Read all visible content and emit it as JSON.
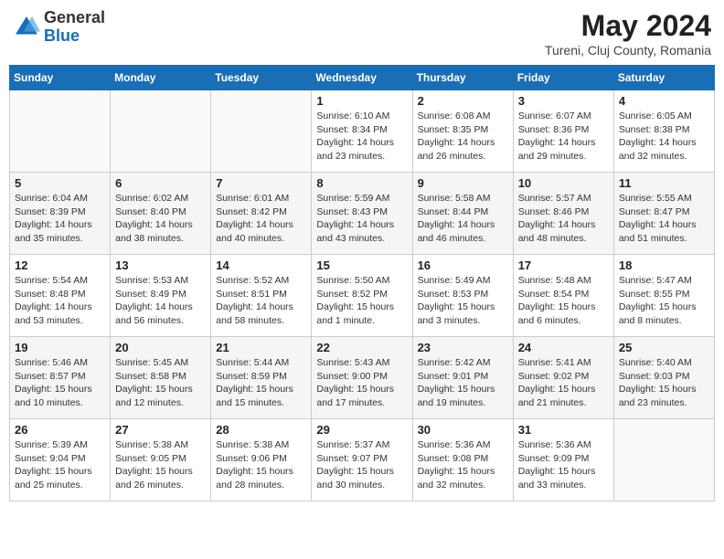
{
  "header": {
    "logo_general": "General",
    "logo_blue": "Blue",
    "month_year": "May 2024",
    "location": "Tureni, Cluj County, Romania"
  },
  "days_of_week": [
    "Sunday",
    "Monday",
    "Tuesday",
    "Wednesday",
    "Thursday",
    "Friday",
    "Saturday"
  ],
  "weeks": [
    [
      {
        "day": "",
        "info": ""
      },
      {
        "day": "",
        "info": ""
      },
      {
        "day": "",
        "info": ""
      },
      {
        "day": "1",
        "info": "Sunrise: 6:10 AM\nSunset: 8:34 PM\nDaylight: 14 hours\nand 23 minutes."
      },
      {
        "day": "2",
        "info": "Sunrise: 6:08 AM\nSunset: 8:35 PM\nDaylight: 14 hours\nand 26 minutes."
      },
      {
        "day": "3",
        "info": "Sunrise: 6:07 AM\nSunset: 8:36 PM\nDaylight: 14 hours\nand 29 minutes."
      },
      {
        "day": "4",
        "info": "Sunrise: 6:05 AM\nSunset: 8:38 PM\nDaylight: 14 hours\nand 32 minutes."
      }
    ],
    [
      {
        "day": "5",
        "info": "Sunrise: 6:04 AM\nSunset: 8:39 PM\nDaylight: 14 hours\nand 35 minutes."
      },
      {
        "day": "6",
        "info": "Sunrise: 6:02 AM\nSunset: 8:40 PM\nDaylight: 14 hours\nand 38 minutes."
      },
      {
        "day": "7",
        "info": "Sunrise: 6:01 AM\nSunset: 8:42 PM\nDaylight: 14 hours\nand 40 minutes."
      },
      {
        "day": "8",
        "info": "Sunrise: 5:59 AM\nSunset: 8:43 PM\nDaylight: 14 hours\nand 43 minutes."
      },
      {
        "day": "9",
        "info": "Sunrise: 5:58 AM\nSunset: 8:44 PM\nDaylight: 14 hours\nand 46 minutes."
      },
      {
        "day": "10",
        "info": "Sunrise: 5:57 AM\nSunset: 8:46 PM\nDaylight: 14 hours\nand 48 minutes."
      },
      {
        "day": "11",
        "info": "Sunrise: 5:55 AM\nSunset: 8:47 PM\nDaylight: 14 hours\nand 51 minutes."
      }
    ],
    [
      {
        "day": "12",
        "info": "Sunrise: 5:54 AM\nSunset: 8:48 PM\nDaylight: 14 hours\nand 53 minutes."
      },
      {
        "day": "13",
        "info": "Sunrise: 5:53 AM\nSunset: 8:49 PM\nDaylight: 14 hours\nand 56 minutes."
      },
      {
        "day": "14",
        "info": "Sunrise: 5:52 AM\nSunset: 8:51 PM\nDaylight: 14 hours\nand 58 minutes."
      },
      {
        "day": "15",
        "info": "Sunrise: 5:50 AM\nSunset: 8:52 PM\nDaylight: 15 hours\nand 1 minute."
      },
      {
        "day": "16",
        "info": "Sunrise: 5:49 AM\nSunset: 8:53 PM\nDaylight: 15 hours\nand 3 minutes."
      },
      {
        "day": "17",
        "info": "Sunrise: 5:48 AM\nSunset: 8:54 PM\nDaylight: 15 hours\nand 6 minutes."
      },
      {
        "day": "18",
        "info": "Sunrise: 5:47 AM\nSunset: 8:55 PM\nDaylight: 15 hours\nand 8 minutes."
      }
    ],
    [
      {
        "day": "19",
        "info": "Sunrise: 5:46 AM\nSunset: 8:57 PM\nDaylight: 15 hours\nand 10 minutes."
      },
      {
        "day": "20",
        "info": "Sunrise: 5:45 AM\nSunset: 8:58 PM\nDaylight: 15 hours\nand 12 minutes."
      },
      {
        "day": "21",
        "info": "Sunrise: 5:44 AM\nSunset: 8:59 PM\nDaylight: 15 hours\nand 15 minutes."
      },
      {
        "day": "22",
        "info": "Sunrise: 5:43 AM\nSunset: 9:00 PM\nDaylight: 15 hours\nand 17 minutes."
      },
      {
        "day": "23",
        "info": "Sunrise: 5:42 AM\nSunset: 9:01 PM\nDaylight: 15 hours\nand 19 minutes."
      },
      {
        "day": "24",
        "info": "Sunrise: 5:41 AM\nSunset: 9:02 PM\nDaylight: 15 hours\nand 21 minutes."
      },
      {
        "day": "25",
        "info": "Sunrise: 5:40 AM\nSunset: 9:03 PM\nDaylight: 15 hours\nand 23 minutes."
      }
    ],
    [
      {
        "day": "26",
        "info": "Sunrise: 5:39 AM\nSunset: 9:04 PM\nDaylight: 15 hours\nand 25 minutes."
      },
      {
        "day": "27",
        "info": "Sunrise: 5:38 AM\nSunset: 9:05 PM\nDaylight: 15 hours\nand 26 minutes."
      },
      {
        "day": "28",
        "info": "Sunrise: 5:38 AM\nSunset: 9:06 PM\nDaylight: 15 hours\nand 28 minutes."
      },
      {
        "day": "29",
        "info": "Sunrise: 5:37 AM\nSunset: 9:07 PM\nDaylight: 15 hours\nand 30 minutes."
      },
      {
        "day": "30",
        "info": "Sunrise: 5:36 AM\nSunset: 9:08 PM\nDaylight: 15 hours\nand 32 minutes."
      },
      {
        "day": "31",
        "info": "Sunrise: 5:36 AM\nSunset: 9:09 PM\nDaylight: 15 hours\nand 33 minutes."
      },
      {
        "day": "",
        "info": ""
      }
    ]
  ]
}
